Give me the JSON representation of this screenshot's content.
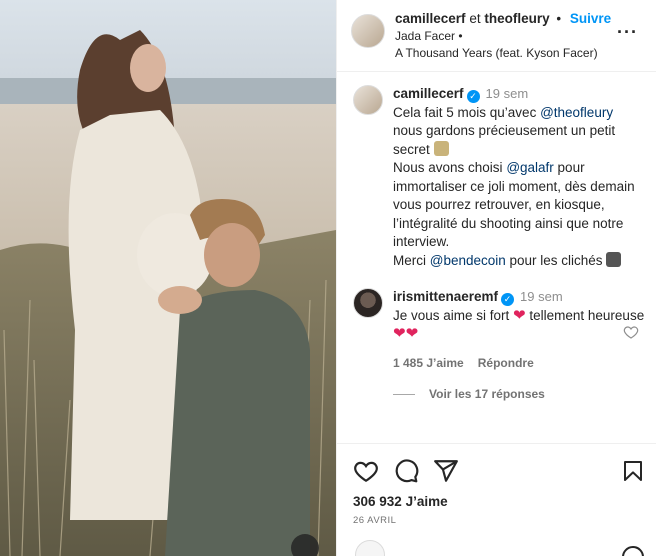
{
  "header": {
    "user1": "camillecerf",
    "conj": "et",
    "user2": "theofleury",
    "dot": "•",
    "follow": "Suivre",
    "audio_artist": "Jada Facer •",
    "audio_title": "A Thousand Years (feat. Kyson Facer)",
    "more": "···"
  },
  "caption": {
    "user": "camillecerf",
    "time": "19 sem",
    "p1a": "Cela fait 5 mois qu’avec ",
    "mention1": "@theofleury",
    "p1b": " nous gardons précieusement un petit secret ",
    "p2a": "Nous avons choisi ",
    "mention2": "@galafr",
    "p2b": " pour immortaliser ce joli moment, dès demain vous pourrez retrouver, en kiosque, l’intégralité du shooting ainsi que notre interview.",
    "p3a": "Merci ",
    "mention3": "@bendecoin",
    "p3b": " pour les clichés "
  },
  "reply": {
    "user": "irismittenaeremf",
    "time": "19 sem",
    "text_a": "Je vous aime si fort ",
    "heart": "❤",
    "text_b": " tellement heureuse ",
    "hearts": "❤❤",
    "likes": "1 485 J’aime",
    "reply_label": "Répondre",
    "view_replies": "Voir les 17 réponses"
  },
  "footer": {
    "likes_count": "306 932",
    "likes_label": "J’aime",
    "date": "26 AVRIL"
  },
  "colors": {
    "link": "#0095f6",
    "mention": "#00376b",
    "heart": "#e0245e"
  }
}
